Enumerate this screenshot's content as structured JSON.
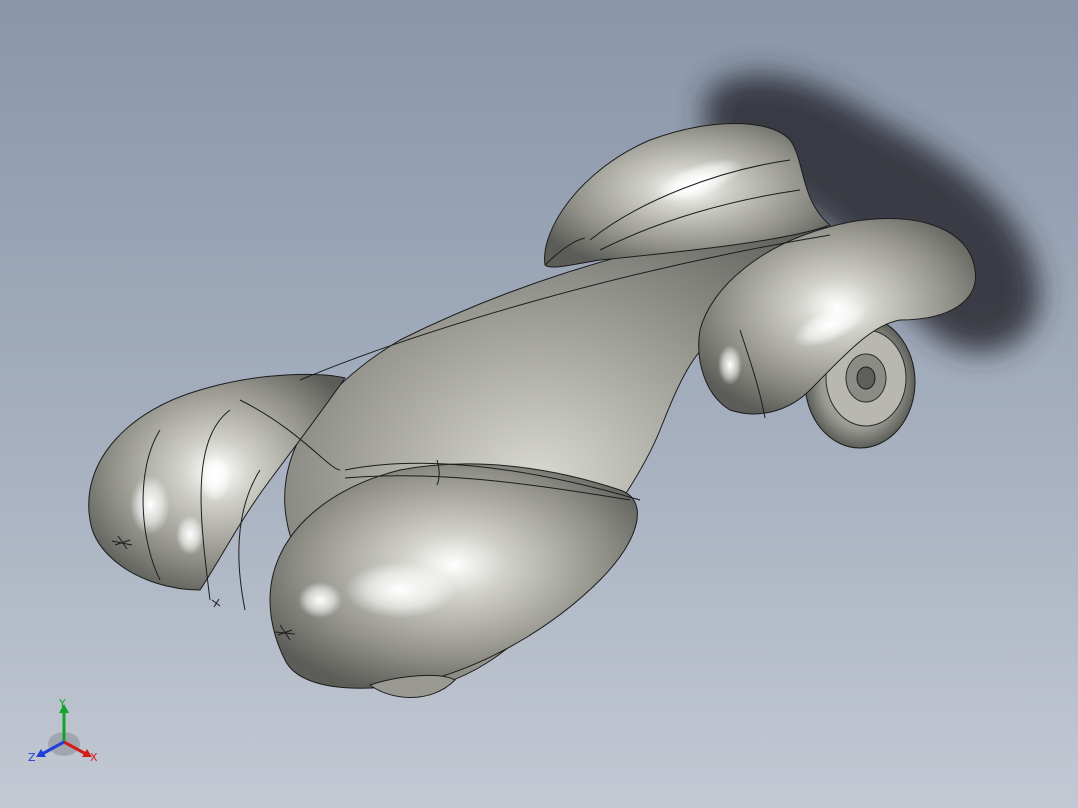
{
  "viewport": {
    "background_top": "#8996aa",
    "background_bottom": "#c3c9d3",
    "model": {
      "body_color": "#9c9c95",
      "highlight_color": "#ffffff",
      "edge_color": "#1c1c1c",
      "shadow_color": "#2a2c30"
    }
  },
  "triad": {
    "x_label": "X",
    "y_label": "Y",
    "z_label": "Z",
    "x_color": "#d41c1c",
    "y_color": "#11a32a",
    "z_color": "#1f3fd6"
  }
}
